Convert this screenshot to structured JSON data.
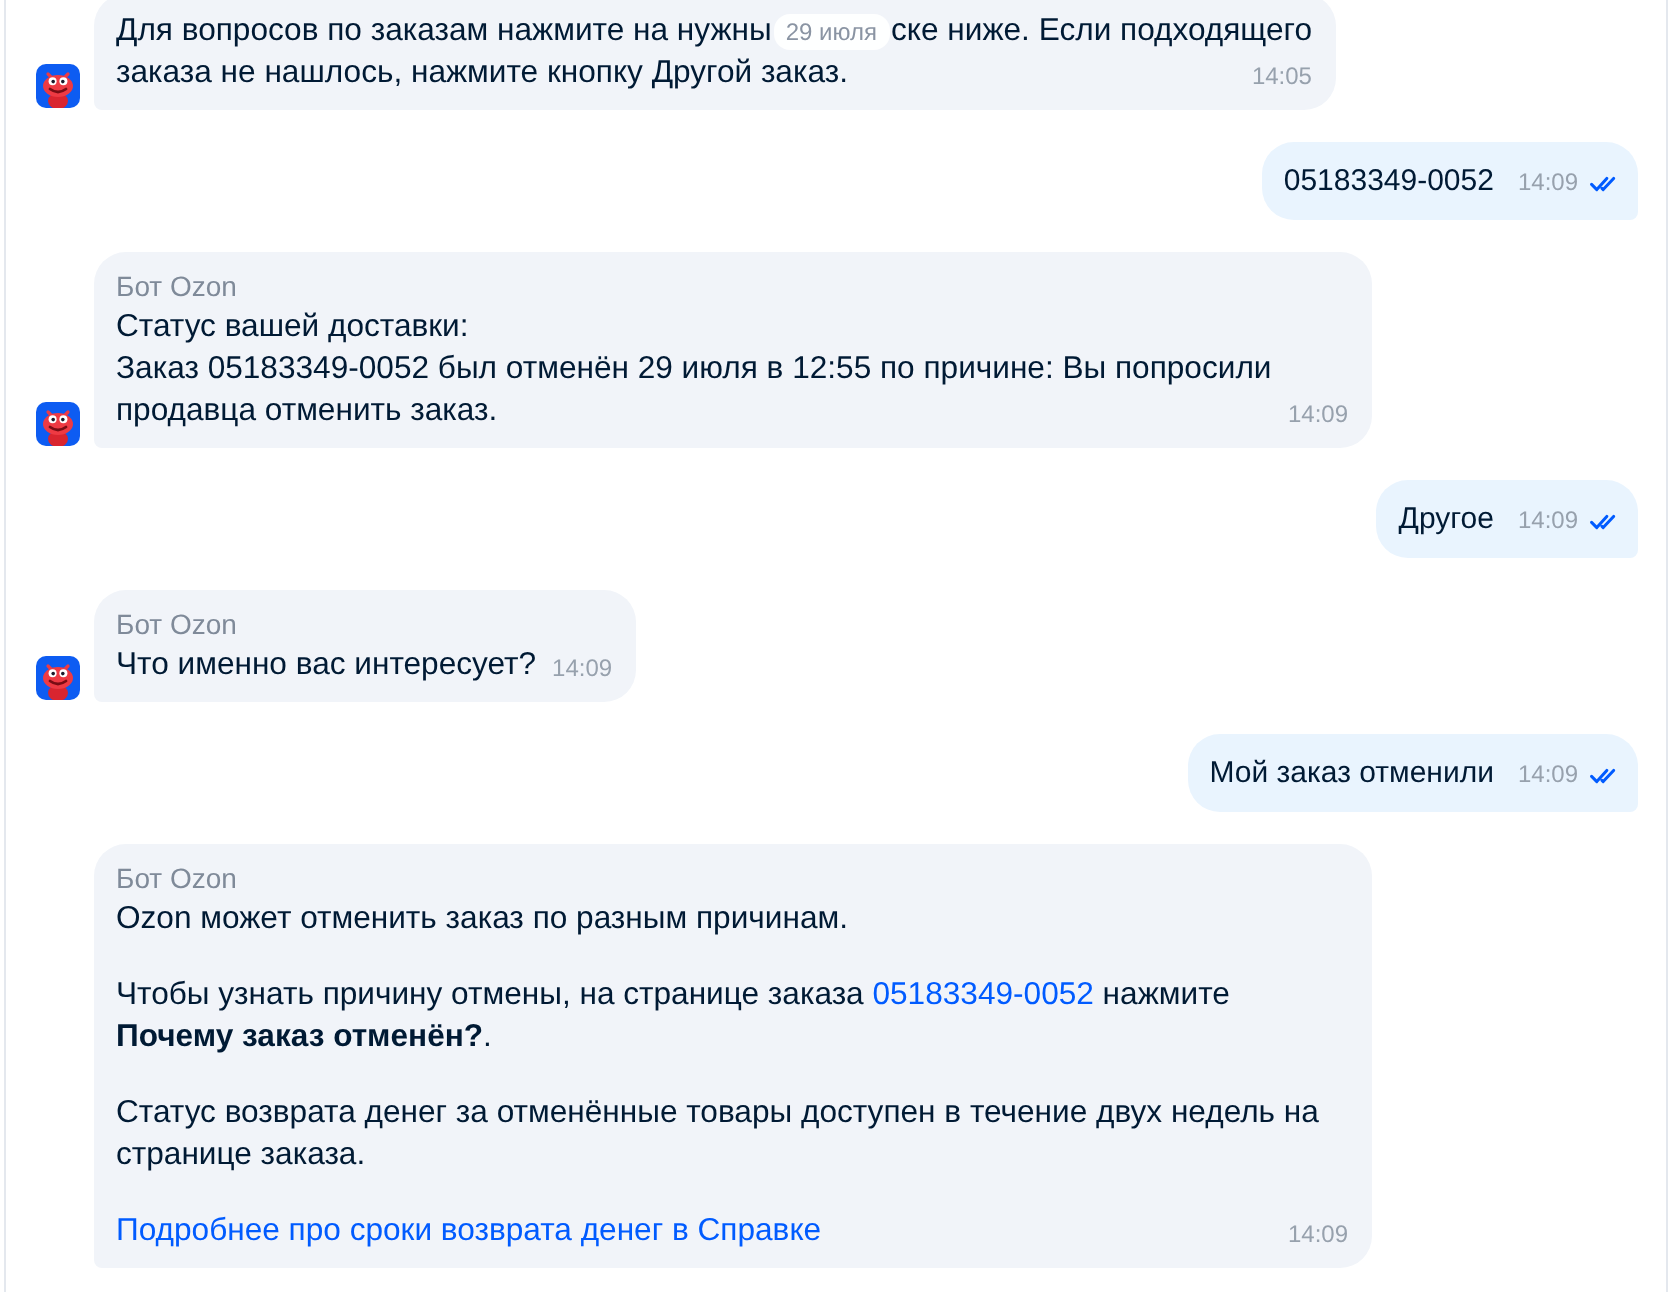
{
  "messages": [
    {
      "kind": "bot",
      "avatar": true,
      "paragraphs": [
        [
          {
            "kind": "overlaid_line",
            "segments": [
              "Для вопросов по заказам нажмите на нужны",
              "ске ниже. Если подходящего"
            ],
            "overlay": "29 июля"
          },
          {
            "kind": "text",
            "text": "заказа не нашлось, нажмите кнопку Другой заказ."
          }
        ]
      ],
      "time": "14:05"
    },
    {
      "kind": "user",
      "text": "05183349-0052",
      "time": "14:09",
      "read": true
    },
    {
      "kind": "bot",
      "avatar": true,
      "author": "Бот Ozon",
      "paragraphs": [
        [
          {
            "kind": "text",
            "text": "Статус вашей доставки:\nЗаказ 05183349-0052 был отменён 29 июля в 12:55 по причине: Вы попросили продавца отменить заказ."
          }
        ]
      ],
      "time": "14:09"
    },
    {
      "kind": "user",
      "text": "Другое",
      "time": "14:09",
      "read": true
    },
    {
      "kind": "bot",
      "avatar": true,
      "author": "Бот Ozon",
      "paragraphs": [
        [
          {
            "kind": "text",
            "text": "Что именно вас интересует?"
          }
        ]
      ],
      "time": "14:09"
    },
    {
      "kind": "user",
      "text": "Мой заказ отменили",
      "time": "14:09",
      "read": true
    },
    {
      "kind": "bot",
      "avatar": false,
      "author": "Бот Ozon",
      "paragraphs": [
        [
          {
            "kind": "text",
            "text": "Ozon может отменить заказ по разным причинам."
          }
        ],
        [
          {
            "kind": "rich_text",
            "segments": [
              {
                "kind": "plain",
                "text": "Чтобы узнать причину отмены, на странице заказа "
              },
              {
                "kind": "link",
                "text": "05183349-0052"
              },
              {
                "kind": "plain",
                "text": " нажмите **Почему заказ отменён?**."
              }
            ]
          }
        ],
        [
          {
            "kind": "text",
            "text": "Статус возврата денег за отменённые товары доступен в течение двух недель на странице заказа."
          }
        ],
        [
          {
            "kind": "link",
            "text": "Подробнее про сроки возврата денег в Справке"
          }
        ]
      ],
      "time": "14:09"
    }
  ]
}
